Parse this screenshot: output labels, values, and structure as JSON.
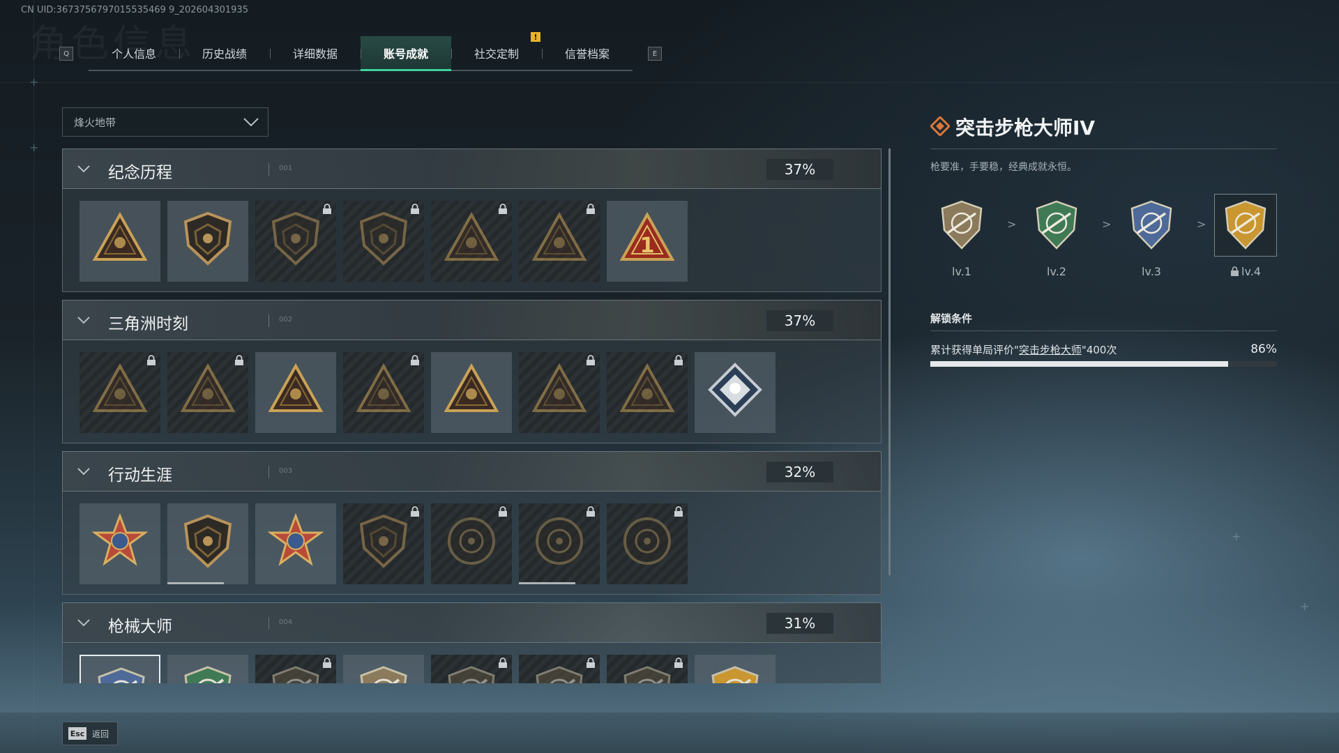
{
  "uid_text": "CN UID:3673756797015535469 9_202604301935",
  "background_title": "角色信息",
  "tab_keys": {
    "left": "Q",
    "right": "E"
  },
  "tabs": [
    {
      "label": "个人信息",
      "active": false
    },
    {
      "label": "历史战绩",
      "active": false
    },
    {
      "label": "详细数据",
      "active": false
    },
    {
      "label": "账号成就",
      "active": true
    },
    {
      "label": "社交定制",
      "active": false
    },
    {
      "label": "信誉档案",
      "active": false
    }
  ],
  "tab_alert": "!",
  "mode_dropdown": {
    "value": "烽火地带"
  },
  "sections": [
    {
      "title": "纪念历程",
      "code": "001",
      "percent": "37%",
      "medals": [
        {
          "icon": "triangle-emblem-icon",
          "locked": false
        },
        {
          "icon": "helicopter-shield-icon",
          "locked": false
        },
        {
          "icon": "shield-emblem-icon",
          "locked": true
        },
        {
          "icon": "soldier-emblem-icon",
          "locked": true
        },
        {
          "icon": "triangle-hood-icon",
          "locked": true
        },
        {
          "icon": "crossed-swords-icon",
          "locked": true
        },
        {
          "icon": "number-one-triangle-icon",
          "locked": false
        }
      ]
    },
    {
      "title": "三角洲时刻",
      "code": "002",
      "percent": "37%",
      "medals": [
        {
          "icon": "triangle-bottle-icon",
          "locked": true
        },
        {
          "icon": "triangle-soldier-icon",
          "locked": true
        },
        {
          "icon": "triangle-seated-icon",
          "locked": false
        },
        {
          "icon": "triangle-dice-icon",
          "locked": true
        },
        {
          "icon": "triangle-squad-icon",
          "locked": false
        },
        {
          "icon": "triangle-beast-icon",
          "locked": true
        },
        {
          "icon": "triangle-wave-icon",
          "locked": true
        },
        {
          "icon": "diamond-rose-icon",
          "locked": false
        }
      ]
    },
    {
      "title": "行动生涯",
      "code": "003",
      "percent": "32%",
      "medals": [
        {
          "icon": "star-medal-icon",
          "locked": false
        },
        {
          "icon": "shield-chevron-icon",
          "locked": false,
          "progress": 0.7
        },
        {
          "icon": "eagle-crest-icon",
          "locked": false
        },
        {
          "icon": "dark-shield-icon",
          "locked": true
        },
        {
          "icon": "round-emblem-icon",
          "locked": true
        },
        {
          "icon": "skull-coin-icon",
          "locked": true,
          "progress": 0.7
        },
        {
          "icon": "eye-coin-icon",
          "locked": true
        }
      ]
    },
    {
      "title": "枪械大师",
      "code": "004",
      "percent": "31%",
      "medals": [
        {
          "icon": "rifle-crest-blue-icon",
          "locked": false,
          "selected": true
        },
        {
          "icon": "rifle-crest-green-icon",
          "locked": false
        },
        {
          "icon": "rifle-crest-icon",
          "locked": true
        },
        {
          "icon": "rifle-crest-bronze-icon",
          "locked": false
        },
        {
          "icon": "rifle-crest-icon",
          "locked": true
        },
        {
          "icon": "rifle-crest-icon",
          "locked": true
        },
        {
          "icon": "rifle-crest-icon",
          "locked": true
        },
        {
          "icon": "rifle-crest-gold-icon",
          "locked": false
        }
      ]
    }
  ],
  "detail": {
    "title": "突击步枪大师IV",
    "description": "枪要准，手要稳，经典成就永恒。",
    "levels": [
      {
        "label": "lv.1",
        "color": "#8b7a5c",
        "locked": false
      },
      {
        "label": "lv.2",
        "color": "#3f7a55",
        "locked": false
      },
      {
        "label": "lv.3",
        "color": "#4d6a99",
        "locked": false
      },
      {
        "label": "lv.4",
        "color": "#c9962f",
        "locked": true,
        "selected": true
      }
    ],
    "level_arrow": ">",
    "unlock_heading": "解锁条件",
    "condition_prefix": "累计获得单局评价\"",
    "condition_link": "突击步枪大师",
    "condition_suffix": "\"400次",
    "progress_text": "86%",
    "progress": 0.86
  },
  "footer": {
    "key": "Esc",
    "label": "返回"
  },
  "colors": {
    "accent": "#3fd49b",
    "gold": "#c9962f",
    "alert": "#e6b32a"
  }
}
